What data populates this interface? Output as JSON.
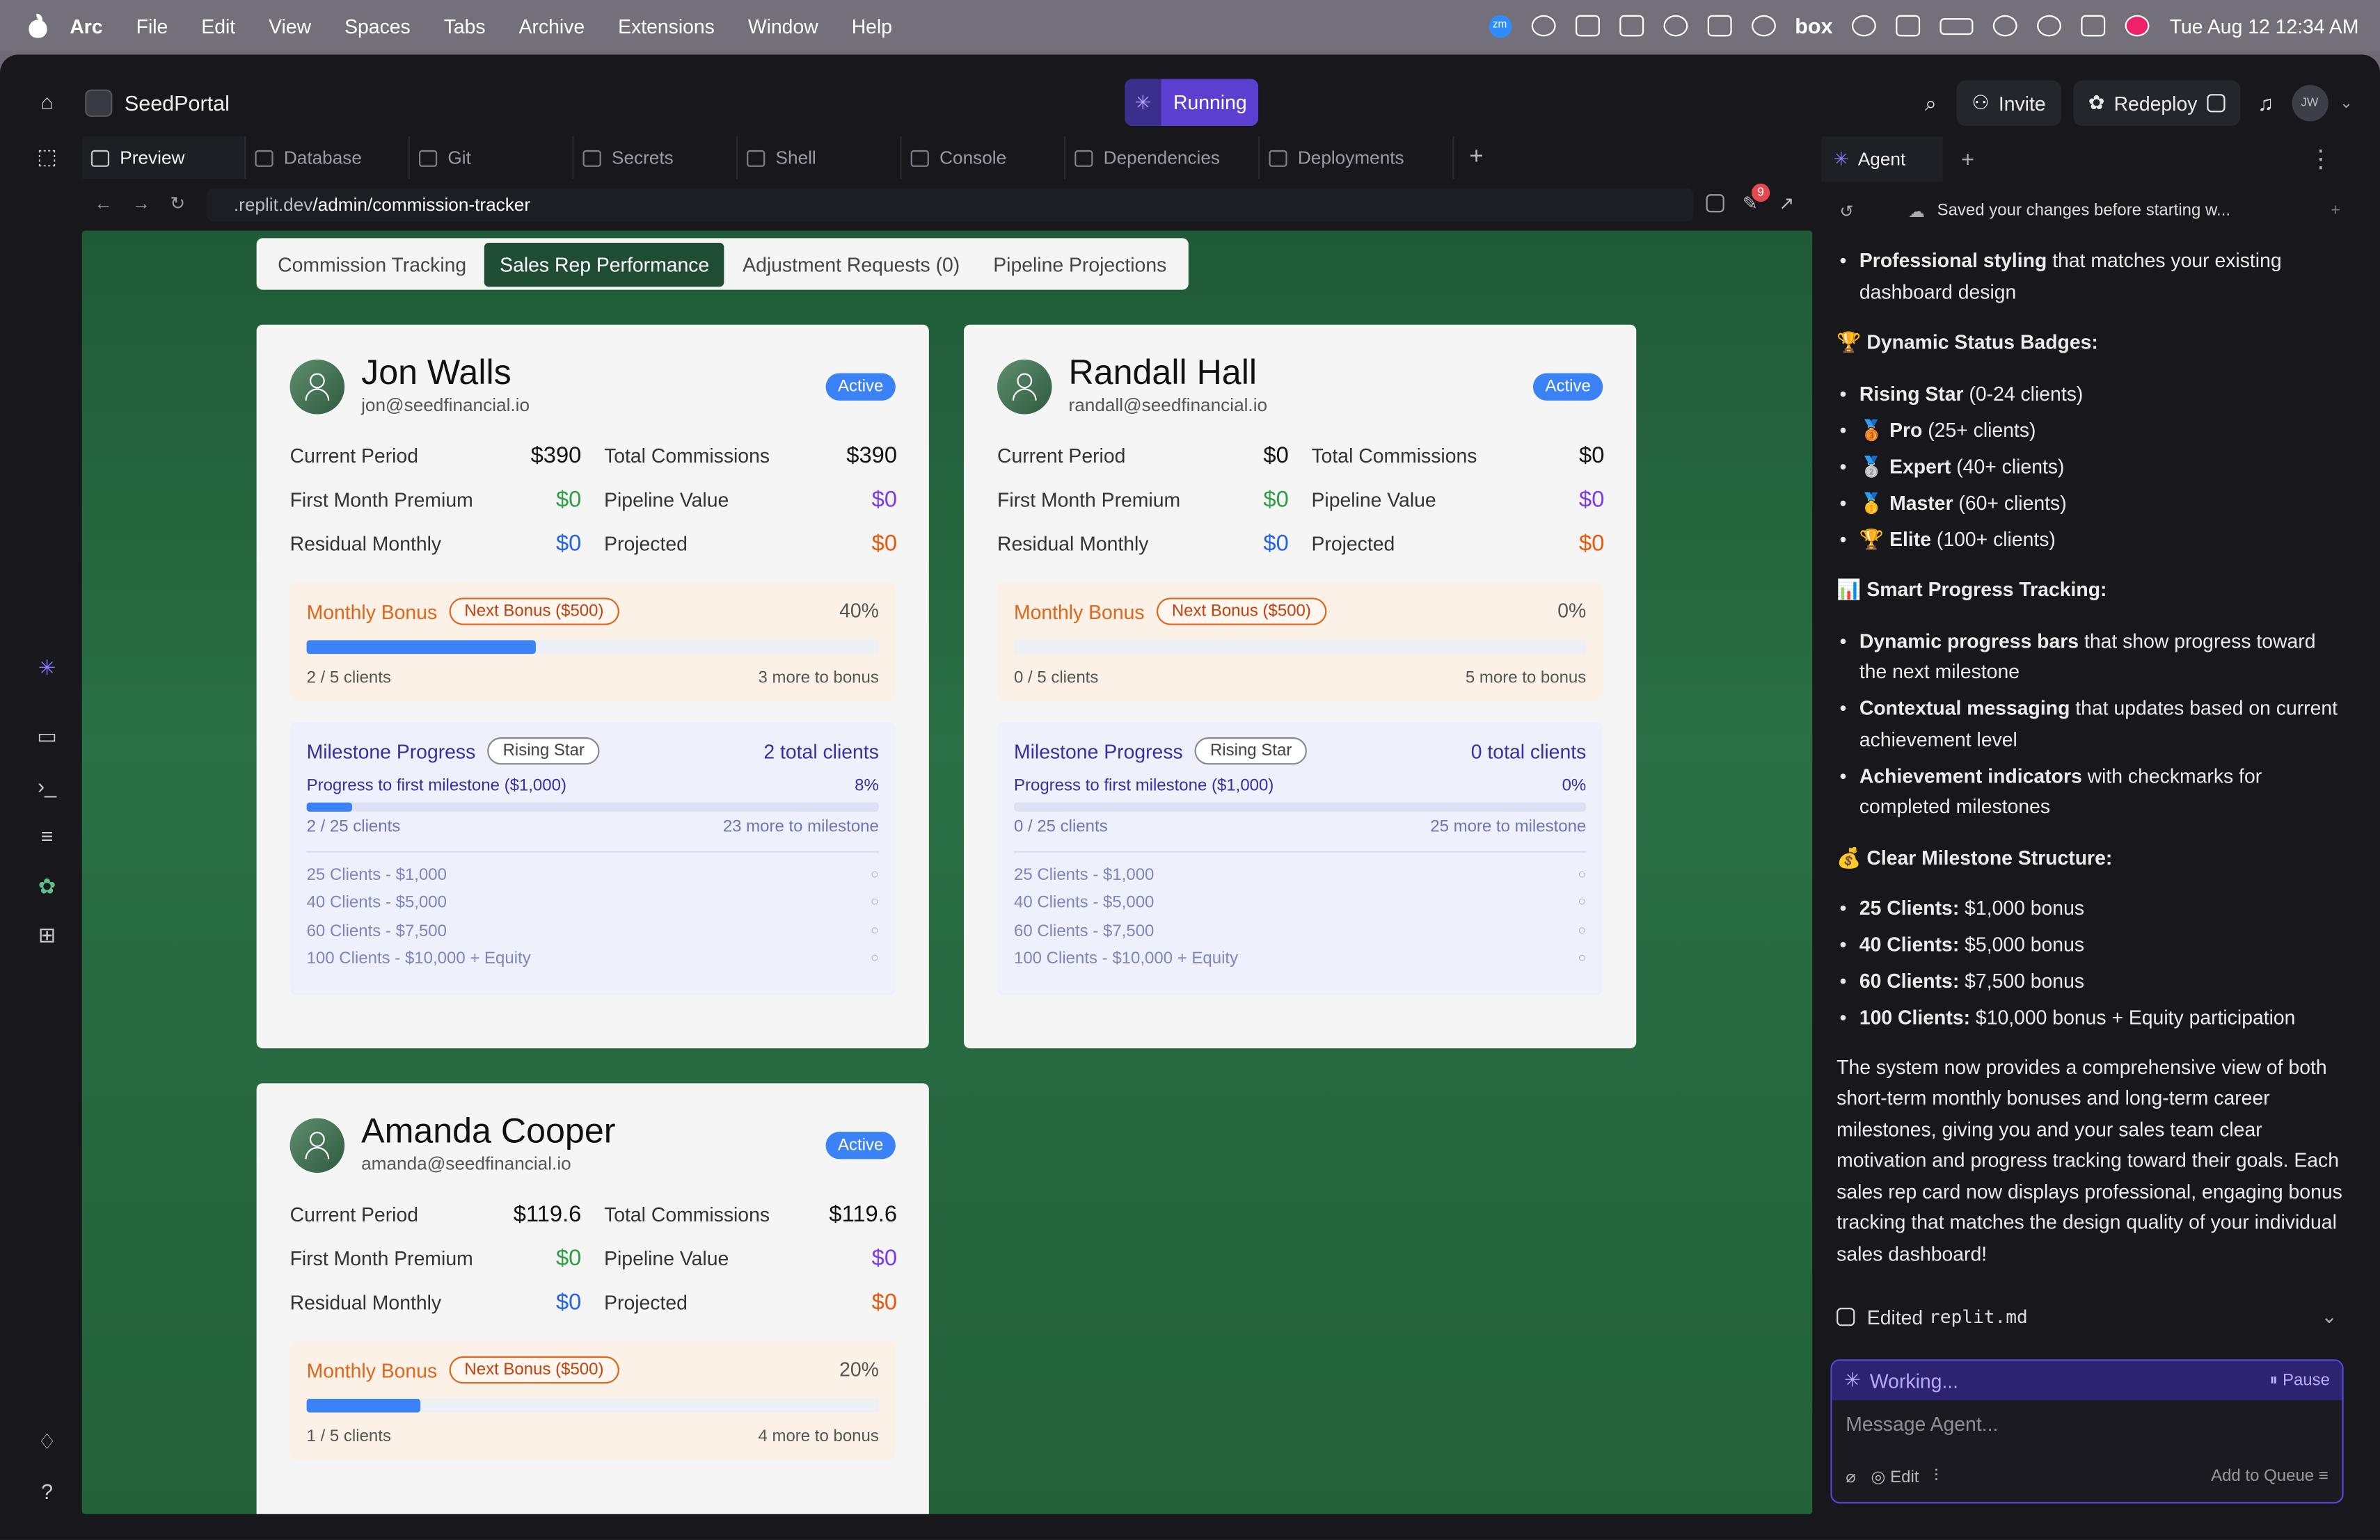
{
  "menubar": {
    "app": "Arc",
    "items": [
      "File",
      "Edit",
      "View",
      "Spaces",
      "Tabs",
      "Archive",
      "Extensions",
      "Window",
      "Help"
    ],
    "datetime": "Tue Aug 12  12:34 AM",
    "box_label": "box",
    "zoom_label": "zm"
  },
  "header": {
    "project": "SeedPortal",
    "run_status": "Running",
    "invite": "Invite",
    "redeploy": "Redeploy",
    "avatar_initials": "JW"
  },
  "tabs": [
    "Preview",
    "Database",
    "Git",
    "Secrets",
    "Shell",
    "Console",
    "Dependencies",
    "Deployments"
  ],
  "url": {
    "domain": ".replit.dev",
    "path": "/admin/commission-tracker",
    "badge_count": "9"
  },
  "subtabs": [
    "Commission Tracking",
    "Sales Rep Performance",
    "Adjustment Requests (0)",
    "Pipeline Projections"
  ],
  "labels": {
    "current_period": "Current Period",
    "total_commissions": "Total Commissions",
    "first_month": "First Month Premium",
    "pipeline": "Pipeline Value",
    "residual": "Residual Monthly",
    "projected": "Projected",
    "monthly_bonus": "Monthly Bonus",
    "next_bonus": "Next Bonus ($500)",
    "milestone_progress": "Milestone Progress",
    "progress_first": "Progress to first milestone ($1,000)",
    "m1": "25 Clients - $1,000",
    "m2": "40 Clients - $5,000",
    "m3": "60 Clients - $7,500",
    "m4": "100 Clients - $10,000 + Equity",
    "status": "Active",
    "tier": "Rising Star",
    "circle": "○"
  },
  "reps": [
    {
      "name": "Jon Walls",
      "email": "jon@seedfinancial.io",
      "current_period": "$390",
      "total_commissions": "$390",
      "first_month": "$0",
      "pipeline": "$0",
      "residual": "$0",
      "projected": "$0",
      "bonus_pct": "40%",
      "bonus_fill": 0.4,
      "bonus_clients": "2 / 5 clients",
      "bonus_more": "3 more to bonus",
      "total_clients": "2 total clients",
      "ms_pct": "8%",
      "ms_fill": 0.08,
      "ms_clients": "2 / 25 clients",
      "ms_more": "23 more to milestone"
    },
    {
      "name": "Randall Hall",
      "email": "randall@seedfinancial.io",
      "current_period": "$0",
      "total_commissions": "$0",
      "first_month": "$0",
      "pipeline": "$0",
      "residual": "$0",
      "projected": "$0",
      "bonus_pct": "0%",
      "bonus_fill": 0,
      "bonus_clients": "0 / 5 clients",
      "bonus_more": "5 more to bonus",
      "total_clients": "0 total clients",
      "ms_pct": "0%",
      "ms_fill": 0,
      "ms_clients": "0 / 25 clients",
      "ms_more": "25 more to milestone"
    },
    {
      "name": "Amanda Cooper",
      "email": "amanda@seedfinancial.io",
      "current_period": "$119.6",
      "total_commissions": "$119.6",
      "first_month": "$0",
      "pipeline": "$0",
      "residual": "$0",
      "projected": "$0",
      "bonus_pct": "20%",
      "bonus_fill": 0.2,
      "bonus_clients": "1 / 5 clients",
      "bonus_more": "4 more to bonus"
    }
  ],
  "agent": {
    "tab": "Agent",
    "saved": "Saved your changes before starting w...",
    "p_styling_b": "Professional styling",
    "p_styling": " that matches your existing dashboard design",
    "h_badges": "🏆 Dynamic Status Badges:",
    "badges": [
      {
        "b": "Rising Star",
        "t": " (0-24 clients)",
        "e": ""
      },
      {
        "b": "Pro",
        "t": " (25+ clients)",
        "e": "🥉 "
      },
      {
        "b": "Expert",
        "t": " (40+ clients)",
        "e": "🥈 "
      },
      {
        "b": "Master",
        "t": " (60+ clients)",
        "e": "🥇 "
      },
      {
        "b": "Elite",
        "t": " (100+ clients)",
        "e": "🏆 "
      }
    ],
    "h_progress": "📊 Smart Progress Tracking:",
    "progress": [
      {
        "b": "Dynamic progress bars",
        "t": " that show progress toward the next milestone"
      },
      {
        "b": "Contextual messaging",
        "t": " that updates based on current achievement level"
      },
      {
        "b": "Achievement indicators",
        "t": " with checkmarks for completed milestones"
      }
    ],
    "h_structure": "💰 Clear Milestone Structure:",
    "structure": [
      {
        "b": "25 Clients:",
        "t": " $1,000 bonus"
      },
      {
        "b": "40 Clients:",
        "t": " $5,000 bonus"
      },
      {
        "b": "60 Clients:",
        "t": " $7,500 bonus"
      },
      {
        "b": "100 Clients:",
        "t": " $10,000 bonus + Equity participation"
      }
    ],
    "summary": "The system now provides a comprehensive view of both short-term monthly bonuses and long-term career milestones, giving you and your sales team clear motivation and progress tracking toward their goals. Each sales rep card now displays professional, engaging bonus tracking that matches the design quality of your individual sales dashboard!",
    "edited_prefix": "Edited",
    "edited_file": "replit.md",
    "working": "Working...",
    "pause": "Pause",
    "placeholder": "Message Agent...",
    "edit": "Edit",
    "queue": "Add to Queue"
  }
}
